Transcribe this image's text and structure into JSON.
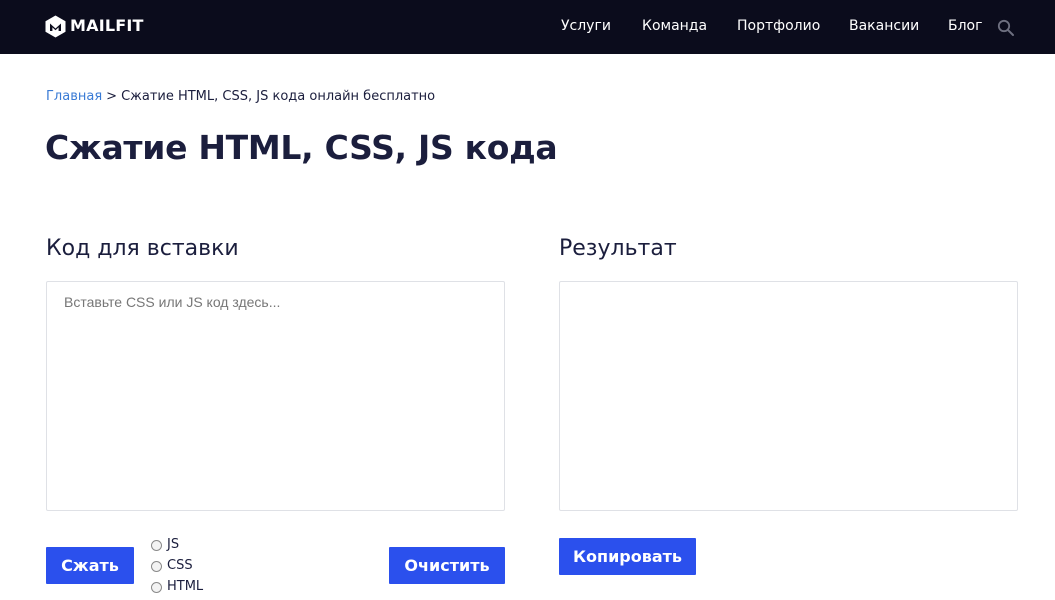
{
  "header": {
    "brand": "MAILFIT",
    "nav": [
      {
        "label": "Услуги"
      },
      {
        "label": "Команда"
      },
      {
        "label": "Портфолио"
      },
      {
        "label": "Вакансии"
      },
      {
        "label": "Блог"
      }
    ]
  },
  "breadcrumb": {
    "home": "Главная",
    "separator": ">",
    "current": "Сжатие HTML, CSS, JS кода онлайн бесплатно"
  },
  "page": {
    "title": "Сжатие HTML, CSS, JS кода"
  },
  "input_panel": {
    "heading": "Код для вставки",
    "placeholder": "Вставьте CSS или JS код здесь...",
    "value": "",
    "compress_label": "Сжать",
    "clear_label": "Очистить",
    "modes": [
      {
        "label": "JS",
        "selected": false
      },
      {
        "label": "CSS",
        "selected": false
      },
      {
        "label": "HTML",
        "selected": false
      }
    ]
  },
  "output_panel": {
    "heading": "Результат",
    "value": "",
    "copy_label": "Копировать"
  },
  "colors": {
    "header_bg": "#0b0c1c",
    "accent": "#2b50ed",
    "link": "#3a7bd5",
    "text": "#1b1e3d"
  }
}
